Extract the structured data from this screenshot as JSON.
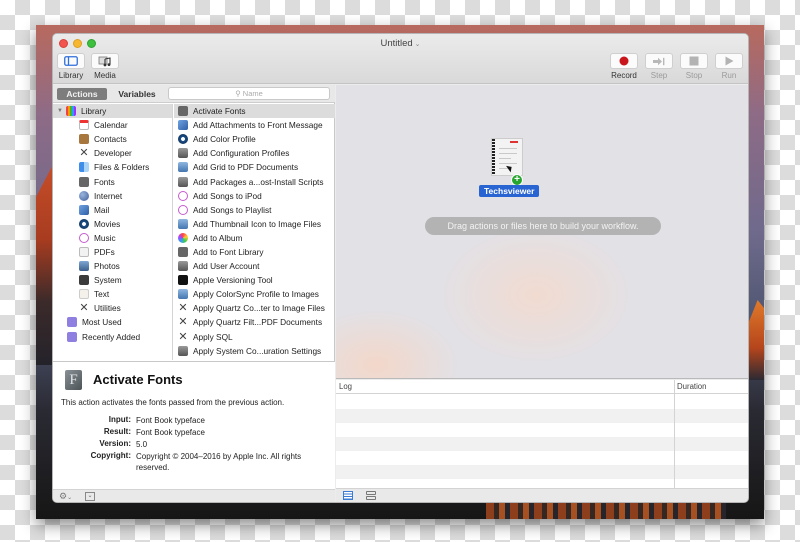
{
  "window": {
    "title": "Untitled",
    "title_chevron": "⌄"
  },
  "toolbar": {
    "left": [
      {
        "id": "library",
        "label": "Library",
        "icon": "sidebar-icon"
      },
      {
        "id": "media",
        "label": "Media",
        "icon": "media-icon"
      }
    ],
    "right": [
      {
        "id": "record",
        "label": "Record",
        "icon": "record-icon",
        "enabled": true
      },
      {
        "id": "step",
        "label": "Step",
        "icon": "step-icon",
        "enabled": false
      },
      {
        "id": "stop",
        "label": "Stop",
        "icon": "stop-icon",
        "enabled": false
      },
      {
        "id": "run",
        "label": "Run",
        "icon": "play-icon",
        "enabled": false
      }
    ]
  },
  "library": {
    "tabs": [
      {
        "label": "Actions",
        "selected": true
      },
      {
        "label": "Variables",
        "selected": false
      }
    ],
    "search": {
      "placeholder": "Name",
      "value": "",
      "icon": "search-icon"
    },
    "categories": [
      {
        "label": "Library",
        "icon": "library-icon",
        "expanded": true,
        "selected": true,
        "level": 0
      },
      {
        "label": "Calendar",
        "icon": "calendar-icon",
        "level": 1
      },
      {
        "label": "Contacts",
        "icon": "contacts-icon",
        "level": 1
      },
      {
        "label": "Developer",
        "icon": "tools-icon",
        "level": 1
      },
      {
        "label": "Files & Folders",
        "icon": "finder-icon",
        "level": 1
      },
      {
        "label": "Fonts",
        "icon": "font-icon",
        "level": 1
      },
      {
        "label": "Internet",
        "icon": "globe-icon",
        "level": 1
      },
      {
        "label": "Mail",
        "icon": "mail-icon",
        "level": 1
      },
      {
        "label": "Movies",
        "icon": "quicktime-icon",
        "level": 1
      },
      {
        "label": "Music",
        "icon": "music-icon",
        "level": 1
      },
      {
        "label": "PDFs",
        "icon": "pdf-icon",
        "level": 1
      },
      {
        "label": "Photos",
        "icon": "photos-icon",
        "level": 1
      },
      {
        "label": "System",
        "icon": "system-icon",
        "level": 1
      },
      {
        "label": "Text",
        "icon": "text-icon",
        "level": 1
      },
      {
        "label": "Utilities",
        "icon": "tools-icon",
        "level": 1
      },
      {
        "label": "Most Used",
        "icon": "smart-folder-icon",
        "level": 0
      },
      {
        "label": "Recently Added",
        "icon": "smart-folder-icon",
        "level": 0
      }
    ],
    "actions": [
      {
        "label": "Activate Fonts",
        "icon": "font-icon",
        "selected": true
      },
      {
        "label": "Add Attachments to Front Message",
        "icon": "mail-icon"
      },
      {
        "label": "Add Color Profile",
        "icon": "quicktime-icon"
      },
      {
        "label": "Add Configuration Profiles",
        "icon": "automator-icon"
      },
      {
        "label": "Add Grid to PDF Documents",
        "icon": "preview-icon"
      },
      {
        "label": "Add Packages a...ost-Install Scripts",
        "icon": "automator-icon"
      },
      {
        "label": "Add Songs to iPod",
        "icon": "music-icon"
      },
      {
        "label": "Add Songs to Playlist",
        "icon": "music-icon"
      },
      {
        "label": "Add Thumbnail Icon to Image Files",
        "icon": "preview-icon"
      },
      {
        "label": "Add to Album",
        "icon": "photos-icon"
      },
      {
        "label": "Add to Font Library",
        "icon": "font-icon"
      },
      {
        "label": "Add User Account",
        "icon": "automator-icon"
      },
      {
        "label": "Apple Versioning Tool",
        "icon": "terminal-icon"
      },
      {
        "label": "Apply ColorSync Profile to Images",
        "icon": "preview-icon"
      },
      {
        "label": "Apply Quartz Co...ter to Image Files",
        "icon": "tools-icon"
      },
      {
        "label": "Apply Quartz Filt...PDF Documents",
        "icon": "tools-icon"
      },
      {
        "label": "Apply SQL",
        "icon": "tools-icon"
      },
      {
        "label": "Apply System Co...uration Settings",
        "icon": "automator-icon"
      }
    ]
  },
  "description": {
    "icon": "font-icon",
    "icon_glyph": "F",
    "title": "Activate Fonts",
    "summary": "This action activates the fonts passed from the previous action.",
    "fields": [
      {
        "key": "Input:",
        "value": "Font Book typeface"
      },
      {
        "key": "Result:",
        "value": "Font Book typeface"
      },
      {
        "key": "Version:",
        "value": "5.0"
      },
      {
        "key": "Copyright:",
        "value": "Copyright © 2004–2016 by Apple Inc. All rights reserved."
      }
    ]
  },
  "workflow": {
    "dragged_item": {
      "label": "Techsviewer",
      "icon": "document-icon",
      "badge": "+"
    },
    "hint": "Drag actions or files here to build your workflow."
  },
  "log": {
    "columns": [
      "Log",
      "Duration"
    ],
    "rows": []
  },
  "colors": {
    "record": "#c9161d",
    "selection_blue": "#2864d2",
    "add_badge": "#27a52f"
  }
}
